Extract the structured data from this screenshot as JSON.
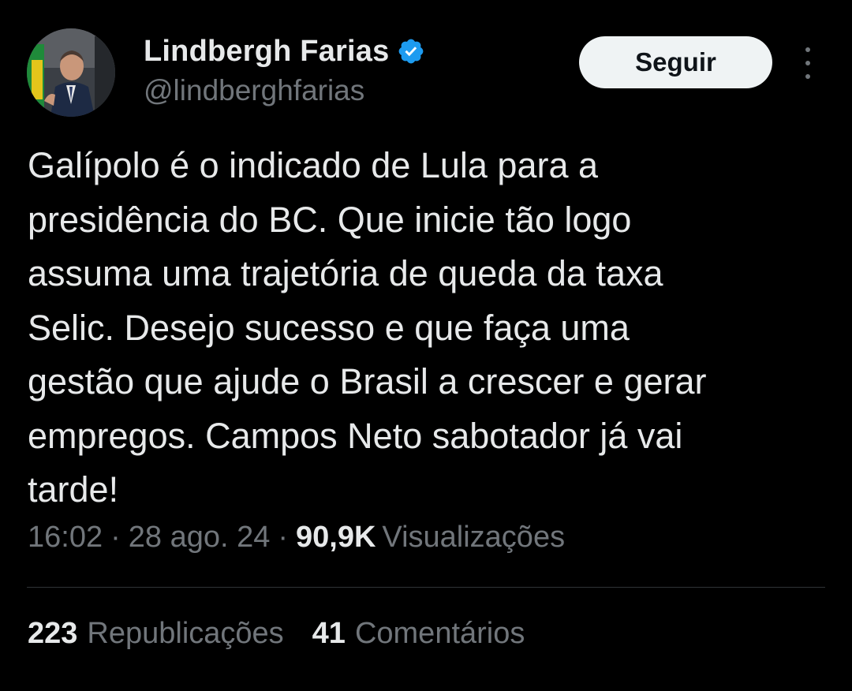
{
  "author": {
    "display_name": "Lindbergh Farias",
    "handle": "@lindberghfarias",
    "verified_badge": "verified-badge-icon",
    "verified_color": "#1d9bf0"
  },
  "header": {
    "follow_label": "Seguir",
    "more_icon": "more-vertical-icon"
  },
  "tweet": {
    "text_lines": [
      "Galípolo é o indicado de Lula para a",
      "presidência do BC. Que inicie tão logo",
      "assuma uma trajetória de queda da taxa",
      "Selic. Desejo sucesso e que faça uma",
      "gestão que ajude o Brasil a crescer e gerar",
      "empregos. Campos Neto sabotador já vai",
      "tarde!"
    ]
  },
  "meta": {
    "time": "16:02",
    "separator": "·",
    "date": "28 ago. 24",
    "views_count": "90,9K",
    "views_label": "Visualizações"
  },
  "stats": {
    "reposts_count": "223",
    "reposts_label": "Republicações",
    "comments_count": "41",
    "comments_label": "Comentários"
  },
  "colors": {
    "background": "#000000",
    "primary_text": "#e7e9ea",
    "secondary_text": "#71767b",
    "divider": "#2f3336",
    "button_bg": "#eff3f4",
    "button_text": "#0f1419"
  }
}
